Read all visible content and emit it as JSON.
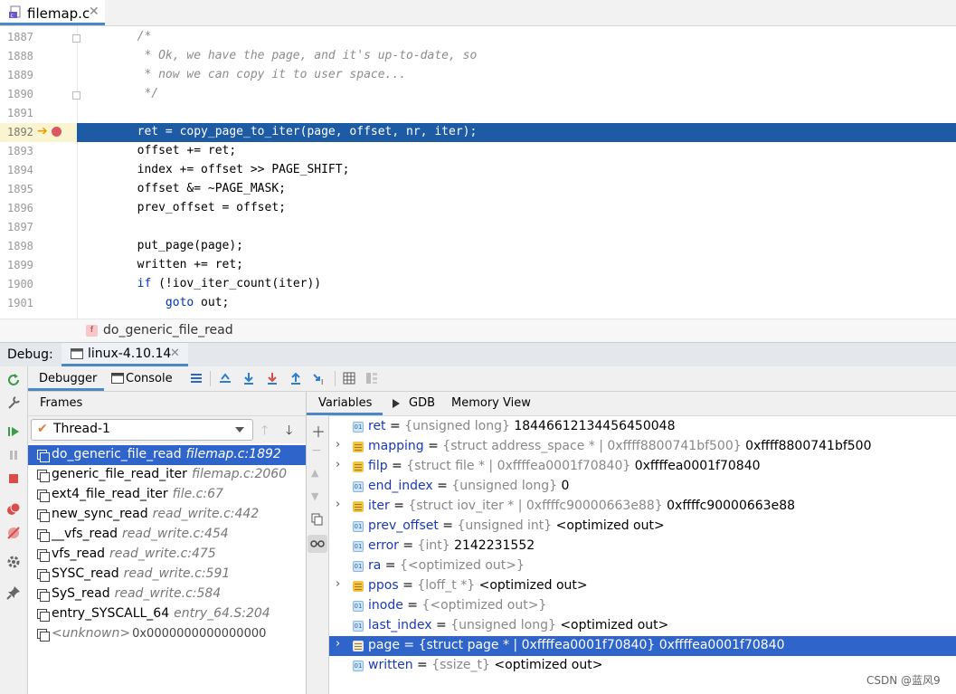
{
  "editor": {
    "file_tab": "filemap.c",
    "lines": [
      {
        "num": "1887",
        "text": "        /*",
        "style": "comment"
      },
      {
        "num": "1888",
        "text": "         * Ok, we have the page, and it's up-to-date, so",
        "style": "comment"
      },
      {
        "num": "1889",
        "text": "         * now we can copy it to user space...",
        "style": "comment"
      },
      {
        "num": "1890",
        "text": "         */",
        "style": "comment"
      },
      {
        "num": "1891",
        "text": "",
        "style": "code"
      },
      {
        "num": "1892",
        "text": "        ret = copy_page_to_iter(page, offset, nr, iter);",
        "style": "current"
      },
      {
        "num": "1893",
        "text": "        offset += ret;",
        "style": "code"
      },
      {
        "num": "1894",
        "text": "        index += offset >> PAGE_SHIFT;",
        "style": "code"
      },
      {
        "num": "1895",
        "text": "        offset &= ~PAGE_MASK;",
        "style": "code"
      },
      {
        "num": "1896",
        "text": "        prev_offset = offset;",
        "style": "code"
      },
      {
        "num": "1897",
        "text": "",
        "style": "code"
      },
      {
        "num": "1898",
        "text": "        put_page(page);",
        "style": "code"
      },
      {
        "num": "1899",
        "text": "        written += ret;",
        "style": "code"
      },
      {
        "num": "1900",
        "text": "        if (!iov_iter_count(iter))",
        "style": "code"
      },
      {
        "num": "1901",
        "text": "            goto out;",
        "style": "code"
      }
    ],
    "breadcrumb": "do_generic_file_read",
    "breadcrumb_icon": "f"
  },
  "debug": {
    "label": "Debug:",
    "run_tab": "linux-4.10.14",
    "tab_debugger": "Debugger",
    "tab_console": "Console"
  },
  "frames": {
    "header": "Frames",
    "thread": "Thread-1",
    "items": [
      {
        "name": "do_generic_file_read",
        "loc": "filemap.c:1892",
        "selected": true
      },
      {
        "name": "generic_file_read_iter",
        "loc": "filemap.c:2060"
      },
      {
        "name": "ext4_file_read_iter",
        "loc": "file.c:67"
      },
      {
        "name": "new_sync_read",
        "loc": "read_write.c:442"
      },
      {
        "name": "__vfs_read",
        "loc": "read_write.c:454"
      },
      {
        "name": "vfs_read",
        "loc": "read_write.c:475"
      },
      {
        "name": "SYSC_read",
        "loc": "read_write.c:591"
      },
      {
        "name": "SyS_read",
        "loc": "read_write.c:584"
      },
      {
        "name": "entry_SYSCALL_64",
        "loc": "entry_64.S:204"
      }
    ],
    "unknown_name": "<unknown>",
    "unknown_addr": "0x0000000000000000"
  },
  "variables": {
    "tab_variables": "Variables",
    "tab_gdb": "GDB",
    "tab_memory": "Memory View",
    "items": [
      {
        "name": "ret",
        "type": "{unsigned long}",
        "value": "18446612134456450048",
        "kind": "prim",
        "expandable": false
      },
      {
        "name": "mapping",
        "type": "{struct address_space * | 0xffff8800741bf500}",
        "value": "0xffff8800741bf500",
        "kind": "struct",
        "expandable": true
      },
      {
        "name": "filp",
        "type": "{struct file * | 0xffffea0001f70840}",
        "value": "0xffffea0001f70840",
        "kind": "struct",
        "expandable": true
      },
      {
        "name": "end_index",
        "type": "{unsigned long}",
        "value": "0",
        "kind": "prim",
        "expandable": false
      },
      {
        "name": "iter",
        "type": "{struct iov_iter * | 0xffffc90000663e88}",
        "value": "0xffffc90000663e88",
        "kind": "struct",
        "expandable": true
      },
      {
        "name": "prev_offset",
        "type": "{unsigned int}",
        "value": "<optimized out>",
        "kind": "prim",
        "expandable": false
      },
      {
        "name": "error",
        "type": "{int}",
        "value": "2142231552",
        "kind": "prim",
        "expandable": false
      },
      {
        "name": "ra",
        "type": "{<optimized out>}",
        "value": "",
        "kind": "prim",
        "expandable": false
      },
      {
        "name": "ppos",
        "type": "{loff_t *}",
        "value": "<optimized out>",
        "kind": "struct",
        "expandable": true
      },
      {
        "name": "inode",
        "type": "{<optimized out>}",
        "value": "",
        "kind": "prim",
        "expandable": false
      },
      {
        "name": "last_index",
        "type": "{unsigned long}",
        "value": "<optimized out>",
        "kind": "prim",
        "expandable": false
      },
      {
        "name": "page",
        "type": "{struct page * | 0xffffea0001f70840}",
        "value": "0xffffea0001f70840",
        "kind": "struct",
        "expandable": true,
        "selected": true
      },
      {
        "name": "written",
        "type": "{ssize_t}",
        "value": "<optimized out>",
        "kind": "prim",
        "expandable": false
      }
    ]
  },
  "watermark": "CSDN @蓝风9",
  "colors": {
    "selection": "#2f65ca",
    "current_line": "#1d5ba5",
    "accent": "#4a88c7"
  }
}
